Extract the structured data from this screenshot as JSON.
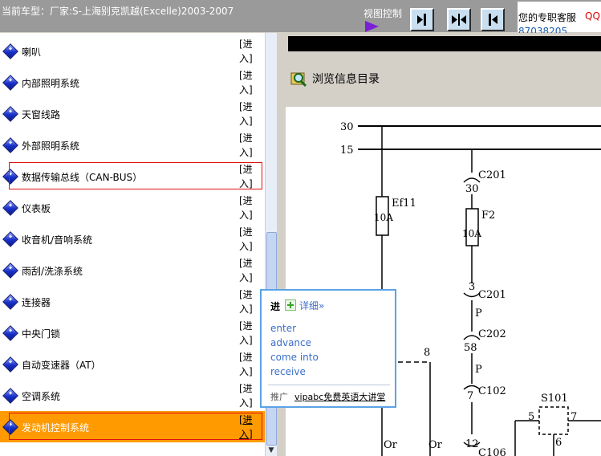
{
  "header": {
    "car_model": "当前车型：厂家:S-上海别克凯越(Excelle)2003-2007",
    "view_control_label": "视图控制",
    "support_text": "您的专职客服",
    "support_qq": "QQ",
    "support_phone": "87038205"
  },
  "systems": {
    "enter_label": "[进入]",
    "items": [
      {
        "label": "喇叭"
      },
      {
        "label": "内部照明系统"
      },
      {
        "label": "天窗线路"
      },
      {
        "label": "外部照明系统"
      },
      {
        "label": "数据传输总线（CAN-BUS）",
        "boxed": true
      },
      {
        "label": "仪表板"
      },
      {
        "label": "收音机/音响系统"
      },
      {
        "label": "雨刮/洗涤系统"
      },
      {
        "label": "连接器"
      },
      {
        "label": "中央门锁"
      },
      {
        "label": "自动变速器（AT）"
      },
      {
        "label": "空调系统"
      },
      {
        "label": "发动机控制系统",
        "selected": true,
        "boxed": true
      }
    ]
  },
  "viewer": {
    "browse_label": "浏览信息目录"
  },
  "diagram": {
    "bus_labels": [
      "30",
      "15"
    ],
    "fuse_labels": [
      "Ef11",
      "10A",
      "F2",
      "10A"
    ],
    "connector_labels": [
      "C201",
      "30",
      "3",
      "C201",
      "C202",
      "58",
      "7",
      "C102",
      "12",
      "C106",
      "8"
    ],
    "wire_colors": [
      "P",
      "P",
      "Or",
      "Or"
    ],
    "splice_label": "S101",
    "splice_pins": [
      "5",
      "7",
      "6"
    ]
  },
  "popup": {
    "word": "进",
    "detail_link": "详细»",
    "definitions": [
      "enter",
      "advance",
      "come into",
      "receive"
    ],
    "ad_prefix": "推广",
    "ad_link": "vipabc免费英语大讲堂"
  },
  "colors": {
    "selected_row": "#ff9a00",
    "highlight_box": "#e01010",
    "popup_border": "#5aa3e6",
    "link_blue": "#3b6ec8"
  }
}
